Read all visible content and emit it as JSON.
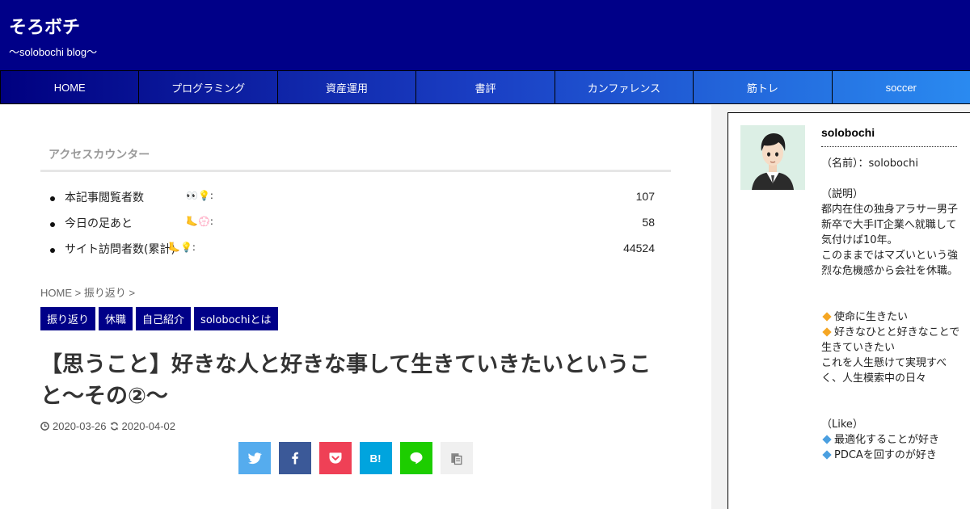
{
  "header": {
    "site_title": "そろボチ",
    "tagline": "〜solobochi blog〜"
  },
  "nav": {
    "items": [
      {
        "label": "HOME"
      },
      {
        "label": "プログラミング"
      },
      {
        "label": "資産運用"
      },
      {
        "label": "書評"
      },
      {
        "label": "カンファレンス"
      },
      {
        "label": "筋トレ"
      },
      {
        "label": "soccer"
      }
    ]
  },
  "counter": {
    "title": "アクセスカウンター",
    "rows": [
      {
        "label": "本記事閲覧者数",
        "emoji": "👀💡:",
        "value": "107"
      },
      {
        "label": "今日の足あと",
        "emoji": "🦶💮:",
        "value": "58"
      },
      {
        "label": "サイト訪問者数(累計)",
        "emoji": "🦶💡:",
        "value": "44524"
      }
    ]
  },
  "breadcrumb": {
    "home": "HOME",
    "sep1": " > ",
    "category": "振り返り",
    "sep2": " >"
  },
  "tags": [
    "振り返り",
    "休職",
    "自己紹介",
    "solobochiとは"
  ],
  "post": {
    "title": "【思うこと】好きな人と好きな事して生きていきたいということ〜その②〜",
    "published": "2020-03-26",
    "updated": "2020-04-02"
  },
  "share": {
    "twitter_color": "#55acee",
    "facebook_color": "#3b5998",
    "pocket_color": "#ef4056",
    "hatena_color": "#00a4de",
    "line_color": "#1dcd00",
    "copy_color": "#f0f0f0"
  },
  "profile": {
    "name": "solobochi",
    "lines": [
      "（名前）：solobochi",
      "",
      "（説明）",
      "都内在住の独身アラサー男子",
      "新卒で大手IT企業へ就職して気付けば10年。",
      "このままではマズいという強烈な危機感から会社を休職。",
      "",
      "",
      "使命に生きたい",
      "好きなひとと好きなことで生きていきたい",
      "これを人生懸けて実現すべく、人生模索中の日々",
      "",
      "",
      "（Like）",
      "最適化することが好き",
      "PDCAを回すのが好き"
    ]
  }
}
